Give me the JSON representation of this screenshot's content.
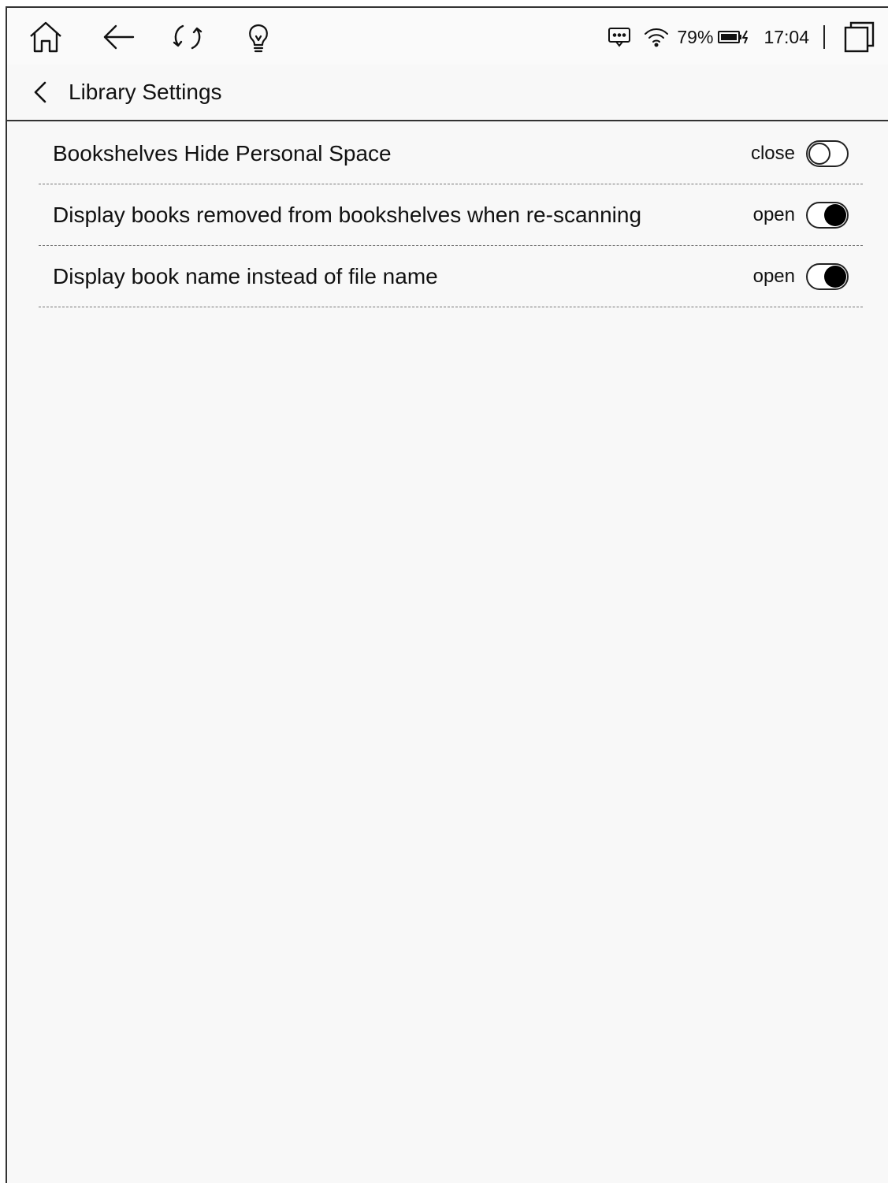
{
  "status_bar": {
    "battery": "79%",
    "time": "17:04"
  },
  "icons": {
    "home": "home-icon",
    "back": "back-arrow-icon",
    "refresh": "refresh-icon",
    "light": "lightbulb-icon",
    "message": "message-icon",
    "wifi": "wifi-icon",
    "battery": "battery-charging-icon",
    "recent": "recent-apps-icon"
  },
  "header": {
    "title": "Library Settings"
  },
  "settings": [
    {
      "label": "Bookshelves Hide Personal Space",
      "state": "close",
      "enabled": false
    },
    {
      "label": "Display books removed from bookshelves when re-scanning",
      "state": "open",
      "enabled": true
    },
    {
      "label": "Display book name instead of file name",
      "state": "open",
      "enabled": true
    }
  ]
}
